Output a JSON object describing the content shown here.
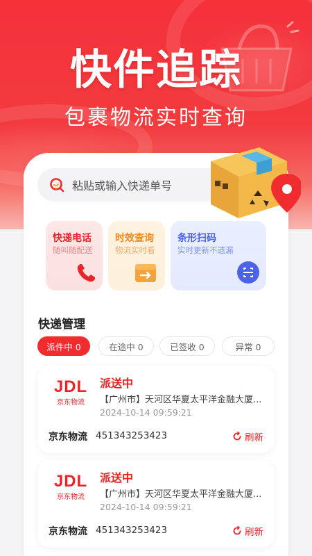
{
  "hero": {
    "title": "快件追踪",
    "subtitle": "包裹物流实时查询"
  },
  "search": {
    "placeholder": "粘贴或输入快递单号"
  },
  "quick_actions": [
    {
      "title": "快递电话",
      "subtitle": "随叫随配送",
      "title_color": "#e8262a",
      "sub_color": "#e98585",
      "icon": "phone-icon"
    },
    {
      "title": "时效查询",
      "subtitle": "物流实时看",
      "title_color": "#f08a1c",
      "sub_color": "#f2a96b",
      "icon": "box-arrow-icon"
    },
    {
      "title": "条形扫码",
      "subtitle": "实时更新不遗漏",
      "title_color": "#4a63e8",
      "sub_color": "#8496ee",
      "icon": "scan-icon"
    }
  ],
  "section": {
    "title": "快递管理"
  },
  "tabs": [
    {
      "label": "派件中 0",
      "active": true
    },
    {
      "label": "在途中 0",
      "active": false
    },
    {
      "label": "已签收 0",
      "active": false
    },
    {
      "label": "异常 0",
      "active": false
    }
  ],
  "packages": [
    {
      "logo_text": "JDL",
      "logo_sub": "京东物流",
      "status": "派送中",
      "address": "【广州市】天河区华夏太平洋金融大厦...",
      "time": "2024-10-14 09:59:21",
      "company": "京东物流",
      "tracking_no": "451343253423",
      "refresh_label": "刷新"
    },
    {
      "logo_text": "JDL",
      "logo_sub": "京东物流",
      "status": "派送中",
      "address": "【广州市】天河区华夏太平洋金融大厦...",
      "time": "2024-10-14 09:59:21",
      "company": "京东物流",
      "tracking_no": "451343253423",
      "refresh_label": "刷新"
    }
  ],
  "colors": {
    "brand_red": "#f02c2f",
    "accent_blue": "#4a63e8"
  }
}
